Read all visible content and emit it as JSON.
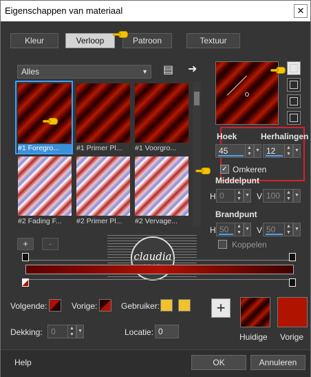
{
  "window": {
    "title": "Eigenschappen van materiaal",
    "close_glyph": "✕"
  },
  "tabs": [
    {
      "label": "Kleur",
      "active": false
    },
    {
      "label": "Verloop",
      "active": true
    },
    {
      "label": "Patroon",
      "active": false
    },
    {
      "label": "Textuur",
      "active": false
    }
  ],
  "library": {
    "category_select": "Alles",
    "thumbnails": [
      {
        "caption": "#1 Foregro...",
        "style": "red",
        "selected": true
      },
      {
        "caption": "#1 Primer Pl...",
        "style": "red",
        "selected": false
      },
      {
        "caption": "#1 Voorgro...",
        "style": "red",
        "selected": false
      },
      {
        "caption": "#2 Fading F...",
        "style": "fade",
        "selected": false
      },
      {
        "caption": "#2 Primer Pl...",
        "style": "fade",
        "selected": false
      },
      {
        "caption": "#2 Vervage...",
        "style": "fade",
        "selected": false
      }
    ],
    "add_glyph": "+",
    "remove_glyph": "-"
  },
  "gradient": {
    "hoek_label": "Hoek",
    "hoek_value": "45",
    "herhalingen_label": "Herhalingen",
    "herhalingen_value": "12",
    "omkeren_label": "Omkeren",
    "omkeren_checked": true,
    "middelpunt_label": "Middelpunt",
    "middelpunt_h_label": "H",
    "middelpunt_h_value": "0",
    "middelpunt_v_label": "V",
    "middelpunt_v_value": "100",
    "brandpunt_label": "Brandpunt",
    "brandpunt_h_label": "H",
    "brandpunt_h_value": "50",
    "brandpunt_v_label": "V",
    "brandpunt_v_value": "50",
    "koppelen_label": "Koppelen"
  },
  "stops": {
    "volgende_label": "Volgende:",
    "vorige_label": "Vorige:",
    "gebruiker_label": "Gebruiker:",
    "dekking_label": "Dekking:",
    "dekking_value": "0",
    "locatie_label": "Locatie:",
    "locatie_value": "0"
  },
  "result": {
    "huidige_label": "Huidige",
    "vorige_label": "Vorige",
    "current_color": "#a01800",
    "previous_color": "#b01400"
  },
  "watermark": {
    "text": "claudia",
    "sub": "tutorials"
  },
  "footer": {
    "help_label": "Help",
    "ok_label": "OK",
    "cancel_label": "Annuleren"
  },
  "colors": {
    "accent_blue": "#3ea0ff",
    "highlight_red": "#d8202a",
    "user_yellow": "#f2c12e"
  }
}
